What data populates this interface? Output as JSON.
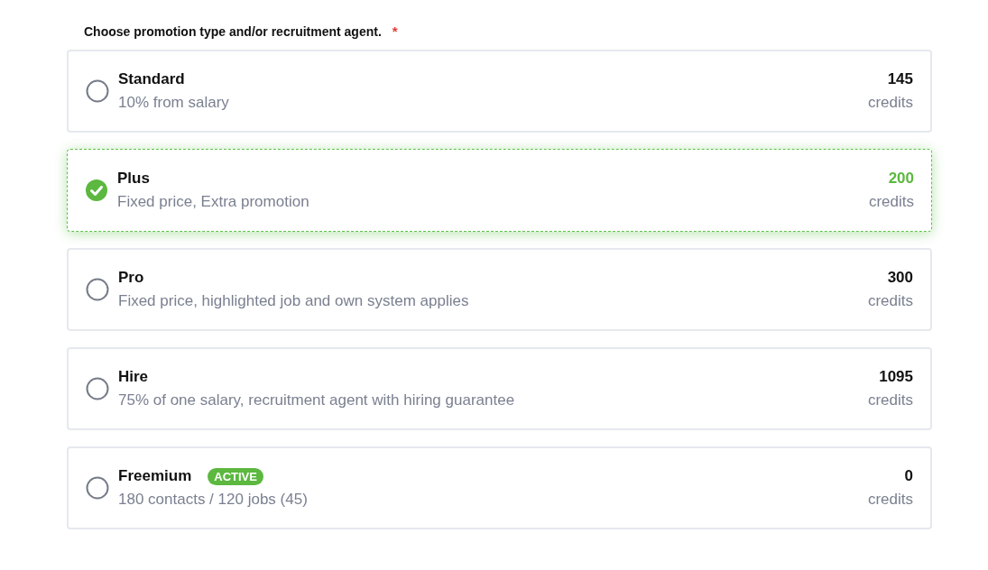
{
  "label": "Choose promotion type and/or recruitment agent.",
  "required_mark": "*",
  "options": [
    {
      "title": "Standard",
      "description": "10% from salary",
      "price": "145",
      "unit": "credits",
      "selected": false
    },
    {
      "title": "Plus",
      "description": "Fixed price, Extra promotion",
      "price": "200",
      "unit": "credits",
      "selected": true
    },
    {
      "title": "Pro",
      "description": "Fixed price, highlighted job and own system applies",
      "price": "300",
      "unit": "credits",
      "selected": false
    },
    {
      "title": "Hire",
      "description": "75% of one salary, recruitment agent with hiring guarantee",
      "price": "1095",
      "unit": "credits",
      "selected": false
    },
    {
      "title": "Freemium",
      "badge": "ACTIVE",
      "description": "180 contacts / 120 jobs (45)",
      "price": "0",
      "unit": "credits",
      "selected": false
    }
  ]
}
